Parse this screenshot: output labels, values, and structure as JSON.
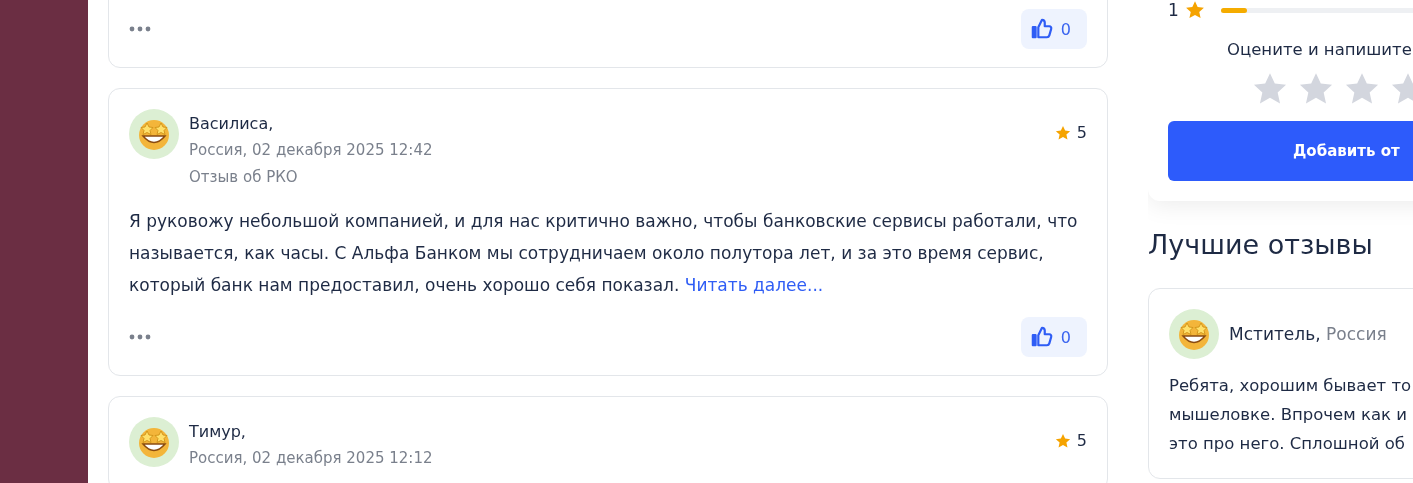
{
  "reviews": [
    {
      "likes": "0"
    },
    {
      "author": "Василиса,",
      "meta": "Россия, 02 декабря 2025 12:42",
      "subject": "Отзыв об РКО",
      "rating": "5",
      "text": "Я руковожу небольшой компанией, и для нас критично важно, чтобы банковские сервисы работали, что называется, как часы. С Альфа Банком мы сотрудничаем около полутора лет, и за это время сервис, который банк нам предоставил, очень хорошо себя показал.",
      "read_more": "Читать далее...",
      "likes": "0"
    },
    {
      "author": "Тимур,",
      "meta": "Россия, 02 декабря 2025 12:12",
      "rating": "5"
    }
  ],
  "rating_panel": {
    "bar_row": {
      "label": "1",
      "level": 0.12
    },
    "prompt": "Оцените и напишите",
    "stars": 0,
    "button": "Добавить от"
  },
  "best_reviews": {
    "title": "Лучшие отзывы",
    "items": [
      {
        "author": "Мститель,",
        "country": "Россия",
        "lines": [
          "Ребята, хорошим бывает то",
          "мышеловке. Впрочем как и",
          "это про него. Сплошной об"
        ]
      }
    ]
  }
}
